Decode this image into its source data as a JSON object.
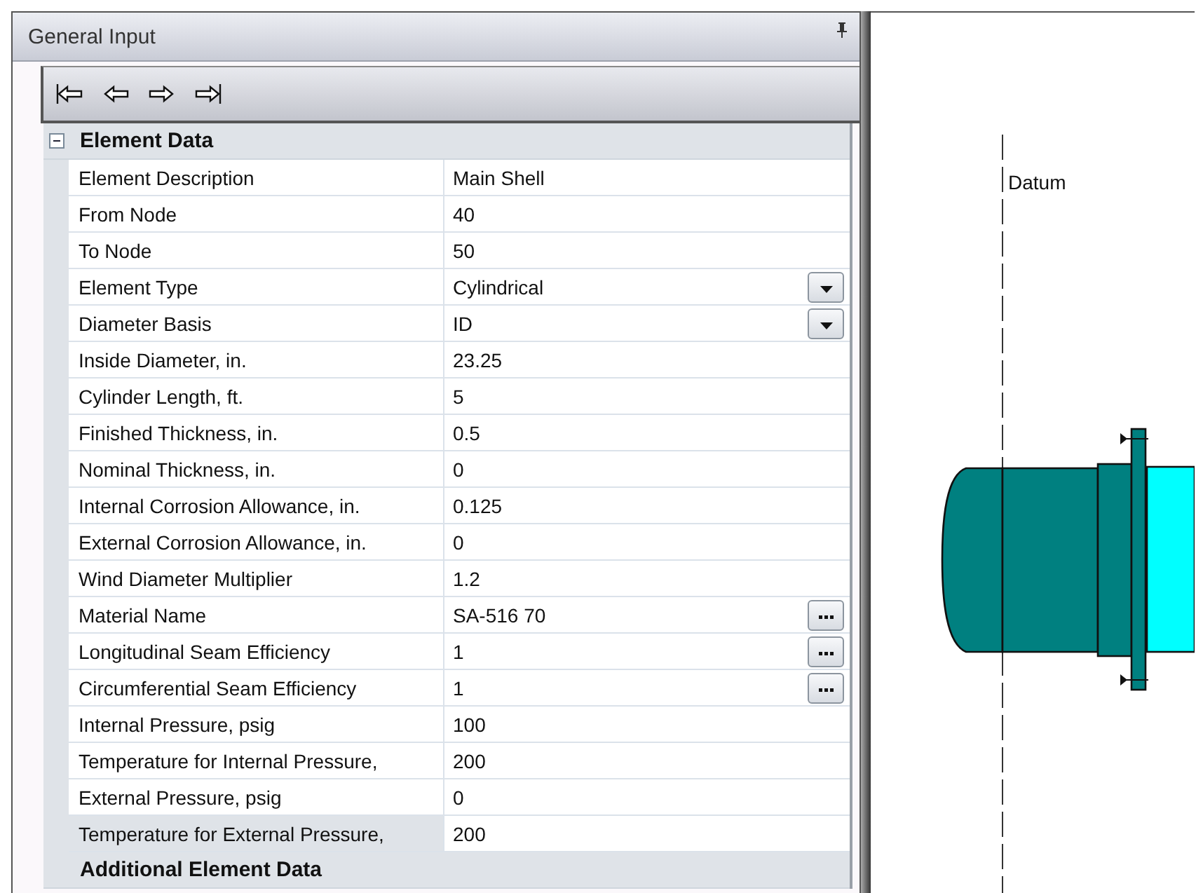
{
  "panel": {
    "title": "General Input"
  },
  "sections": [
    {
      "title": "Element Data",
      "expanded": true,
      "rows": [
        {
          "label": "Element Description",
          "value": "Main Shell",
          "kind": "text",
          "selected": false
        },
        {
          "label": "From Node",
          "value": "40",
          "kind": "text",
          "selected": false
        },
        {
          "label": "To Node",
          "value": "50",
          "kind": "text",
          "selected": false
        },
        {
          "label": "Element Type",
          "value": "Cylindrical",
          "kind": "dropdown",
          "selected": false
        },
        {
          "label": "Diameter Basis",
          "value": "ID",
          "kind": "dropdown",
          "selected": false
        },
        {
          "label": "Inside Diameter, in.",
          "value": "23.25",
          "kind": "text",
          "selected": false
        },
        {
          "label": "Cylinder Length, ft.",
          "value": "5",
          "kind": "text",
          "selected": false
        },
        {
          "label": "Finished Thickness, in.",
          "value": "0.5",
          "kind": "text",
          "selected": false
        },
        {
          "label": "Nominal Thickness,  in.",
          "value": "0",
          "kind": "text",
          "selected": false
        },
        {
          "label": "Internal Corrosion Allowance,  in.",
          "value": "0.125",
          "kind": "text",
          "selected": false
        },
        {
          "label": "External Corrosion Allowance,  in.",
          "value": "0",
          "kind": "text",
          "selected": false
        },
        {
          "label": "Wind Diameter Multiplier",
          "value": "1.2",
          "kind": "text",
          "selected": false
        },
        {
          "label": "Material Name",
          "value": "SA-516 70",
          "kind": "browse",
          "selected": false
        },
        {
          "label": "Longitudinal Seam Efficiency",
          "value": "1",
          "kind": "browse",
          "selected": false
        },
        {
          "label": "Circumferential Seam Efficiency",
          "value": "1",
          "kind": "browse",
          "selected": false
        },
        {
          "label": "Internal Pressure,  psig",
          "value": "100",
          "kind": "text",
          "selected": false
        },
        {
          "label": "Temperature for Internal Pressure,",
          "value": "200",
          "kind": "text",
          "selected": false
        },
        {
          "label": "External Pressure,  psig",
          "value": "0",
          "kind": "text",
          "selected": false
        },
        {
          "label": "Temperature for External Pressure,",
          "value": "200",
          "kind": "text",
          "selected": true
        }
      ]
    },
    {
      "title": "Additional Element Data",
      "expanded": false
    }
  ],
  "drawing": {
    "datum_label": "Datum"
  }
}
